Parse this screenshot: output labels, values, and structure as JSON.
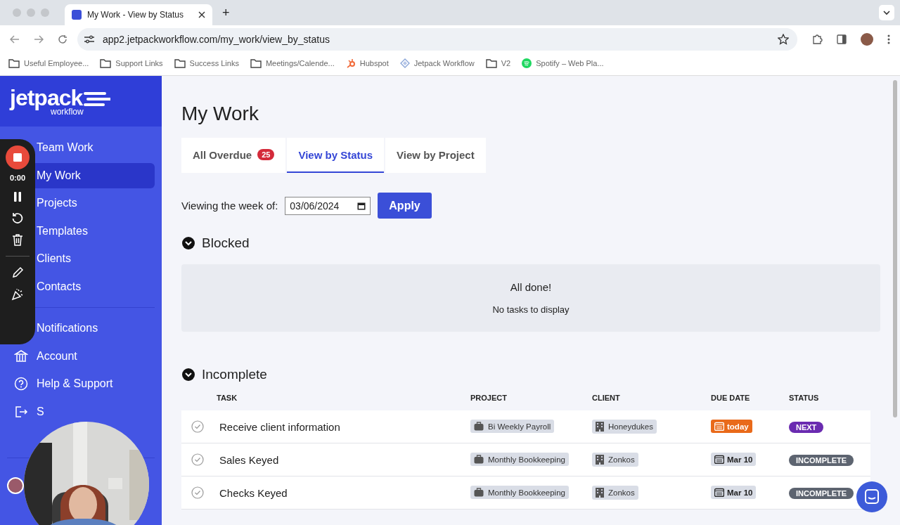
{
  "browser": {
    "tab_title": "My Work - View by Status",
    "new_tab": "+",
    "url": "app2.jetpackworkflow.com/my_work/view_by_status",
    "bookmarks": [
      {
        "kind": "folder",
        "label": "Useful Employee..."
      },
      {
        "kind": "folder",
        "label": "Support Links"
      },
      {
        "kind": "folder",
        "label": "Success Links"
      },
      {
        "kind": "folder",
        "label": "Meetings/Calende..."
      },
      {
        "kind": "hub",
        "label": "Hubspot"
      },
      {
        "kind": "jet",
        "label": "Jetpack Workflow"
      },
      {
        "kind": "folder",
        "label": "V2"
      },
      {
        "kind": "spotify",
        "label": "Spotify – Web Pla..."
      }
    ]
  },
  "sidebar": {
    "logo": "jetpack",
    "logo_sub": "workflow",
    "items": [
      {
        "label": "Team Work",
        "selected": false,
        "kind": "plain"
      },
      {
        "label": "My Work",
        "selected": true,
        "kind": "plain"
      },
      {
        "label": "Projects",
        "selected": false,
        "kind": "plain"
      },
      {
        "label": "Templates",
        "selected": false,
        "kind": "plain"
      },
      {
        "label": "Clients",
        "selected": false,
        "kind": "plain"
      },
      {
        "label": "Contacts",
        "selected": false,
        "kind": "plain"
      },
      {
        "label": "Notifications",
        "selected": false,
        "kind": "plain",
        "divider_before": true
      },
      {
        "label": "Account",
        "selected": false,
        "kind": "account"
      },
      {
        "label": "Help & Support",
        "selected": false,
        "kind": "help"
      },
      {
        "label": "S",
        "selected": false,
        "kind": "signout"
      }
    ]
  },
  "recorder": {
    "time": "0:00"
  },
  "page": {
    "title": "My Work",
    "tabs": [
      {
        "label": "All Overdue",
        "badge": "25",
        "selected": false
      },
      {
        "label": "View by Status",
        "selected": true
      },
      {
        "label": "View by Project",
        "selected": false
      }
    ],
    "week_label": "Viewing the week of:",
    "week_value": "03/06/2024",
    "apply": "Apply",
    "sections": [
      {
        "title": "Blocked",
        "expanded": true,
        "empty_title": "All done!",
        "empty_text": "No tasks to display"
      },
      {
        "title": "Incomplete",
        "expanded": true,
        "columns": [
          "TASK",
          "PROJECT",
          "CLIENT",
          "DUE DATE",
          "STATUS"
        ],
        "rows": [
          {
            "task": "Receive client information",
            "project": "Bi Weekly Payroll",
            "client": "Honeydukes",
            "due": {
              "text": "today",
              "kind": "today"
            },
            "status": {
              "text": "NEXT",
              "kind": "next"
            }
          },
          {
            "task": "Sales Keyed",
            "project": "Monthly Bookkeeping",
            "client": "Zonkos",
            "due": {
              "text": "Mar 10",
              "kind": "date"
            },
            "status": {
              "text": "INCOMPLETE",
              "kind": "incomplete"
            }
          },
          {
            "task": "Checks Keyed",
            "project": "Monthly Bookkeeping",
            "client": "Zonkos",
            "due": {
              "text": "Mar 10",
              "kind": "date"
            },
            "status": {
              "text": "INCOMPLETE",
              "kind": "incomplete"
            }
          }
        ]
      }
    ]
  }
}
